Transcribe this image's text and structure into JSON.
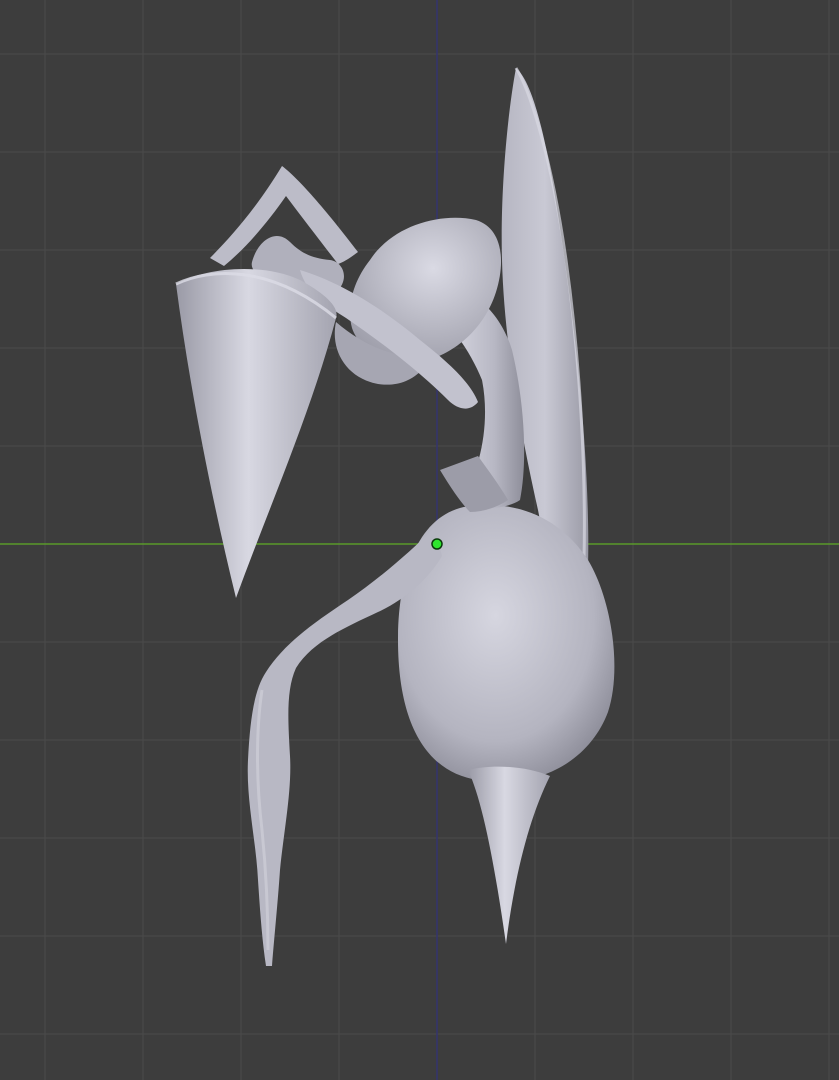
{
  "viewport": {
    "view": "top-orthographic",
    "grid_visible": true,
    "colors": {
      "background": "#3d3d3d",
      "grid_minor": "#464646",
      "grid_major": "#4a4a4a",
      "x_axis": "#5a9a2a",
      "y_axis": "#34346e",
      "mesh": "#b4b4c0",
      "origin_point": "#2ee62e"
    }
  },
  "scene": {
    "selected_object": "mesh-object",
    "shading": "solid-smooth",
    "origin_marker": "object-origin-dot"
  }
}
